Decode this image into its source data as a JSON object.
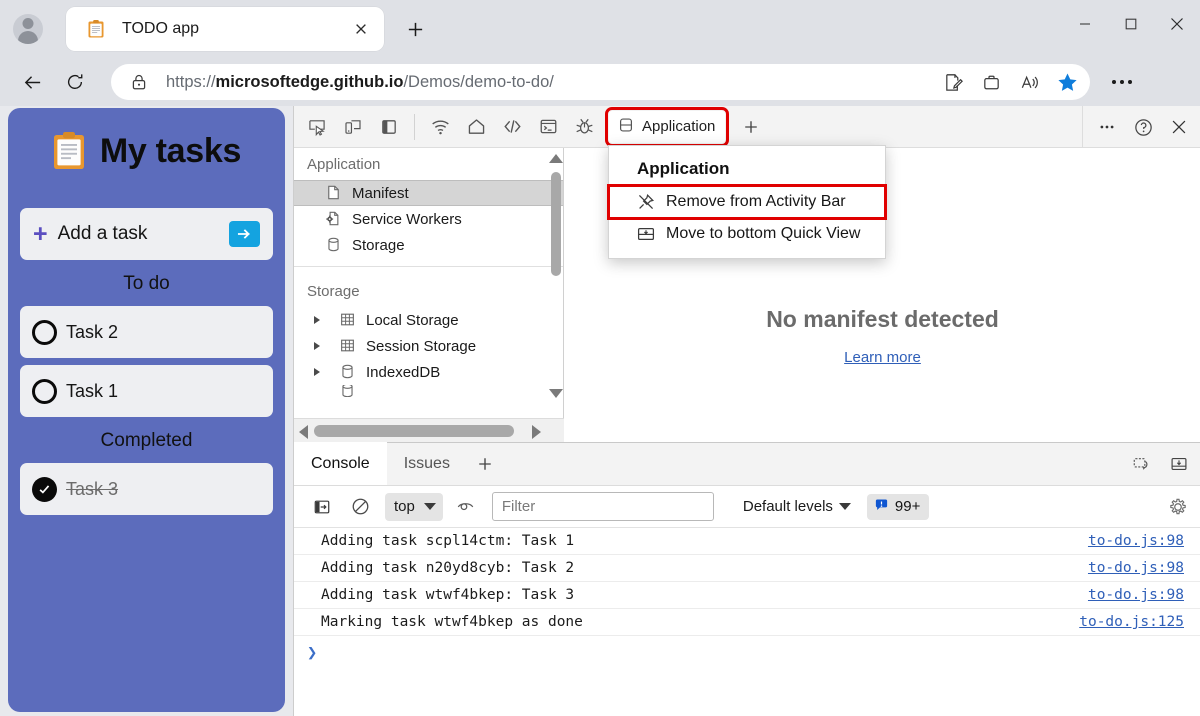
{
  "browser": {
    "profile_icon": "person-avatar-icon",
    "tab": {
      "favicon": "clipboard-icon",
      "title": "TODO app",
      "close_label": "×"
    },
    "new_tab_label": "+",
    "window_controls": {
      "minimize": "—",
      "maximize": "❑",
      "close": "×"
    },
    "nav": {
      "back_icon": "arrow-left-icon",
      "reload_icon": "reload-icon"
    },
    "omnibox": {
      "lock_icon": "lock-icon",
      "url_prefix": "https://",
      "url_host": "microsoftedge.github.io",
      "url_path": "/Demos/demo-to-do/",
      "full_url": "https://microsoftedge.github.io/Demos/demo-to-do/",
      "actions": [
        "read-aloud-icon",
        "collections-icon",
        "immersive-reader-icon",
        "favorites-star-icon"
      ]
    },
    "settings_more_icon": "ellipsis-icon"
  },
  "page": {
    "app_icon": "clipboard-icon",
    "app_title": "My tasks",
    "add_task": {
      "plus": "+",
      "label": "Add a task",
      "submit_icon": "arrow-right-icon"
    },
    "sections": [
      {
        "label": "To do",
        "tasks": [
          {
            "text": "Task 2",
            "done": false
          },
          {
            "text": "Task 1",
            "done": false
          }
        ]
      },
      {
        "label": "Completed",
        "tasks": [
          {
            "text": "Task 3",
            "done": true
          }
        ]
      }
    ],
    "accent_color": "#5c6cbc",
    "card_color": "#eeeff2",
    "submit_color": "#14a3e0"
  },
  "devtools": {
    "activity_bar": {
      "left_icons": [
        "inspect-element-icon",
        "device-emulation-icon",
        "toggle-side-panel-icon"
      ],
      "tool_icons": [
        "network-wifi-icon",
        "home-icon",
        "elements-code-icon",
        "console-terminal-icon",
        "debugger-bug-icon"
      ],
      "active_tab": {
        "icon": "application-storage-icon",
        "label": "Application"
      },
      "add_tab_label": "+",
      "right_icons": [
        "more-options-ellipsis-icon",
        "help-question-icon",
        "close-devtools-icon"
      ],
      "highlight_color": "#e00000"
    },
    "context_menu": {
      "header": "Application",
      "items": [
        {
          "icon": "unpin-icon",
          "label": "Remove from Activity Bar",
          "highlighted": true
        },
        {
          "icon": "move-to-bottom-panel-icon",
          "label": "Move to bottom Quick View",
          "highlighted": false
        }
      ]
    },
    "sidebar": {
      "groups": [
        {
          "title": "Application",
          "items": [
            {
              "icon": "document-icon",
              "label": "Manifest",
              "selected": true,
              "twisty": false
            },
            {
              "icon": "service-worker-gear-icon",
              "label": "Service Workers",
              "selected": false,
              "twisty": false
            },
            {
              "icon": "database-cylinder-icon",
              "label": "Storage",
              "selected": false,
              "twisty": false
            }
          ]
        },
        {
          "title": "Storage",
          "items": [
            {
              "icon": "table-grid-icon",
              "label": "Local Storage",
              "selected": false,
              "twisty": true
            },
            {
              "icon": "table-grid-icon",
              "label": "Session Storage",
              "selected": false,
              "twisty": true
            },
            {
              "icon": "database-cylinder-icon",
              "label": "IndexedDB",
              "selected": false,
              "twisty": true
            }
          ]
        }
      ],
      "vscroll_icon": "vertical-scrollbar",
      "hscroll_icon": "horizontal-scrollbar"
    },
    "main_panel": {
      "empty_heading": "No manifest detected",
      "learn_more_label": "Learn more",
      "learn_more_color": "#2f5fb8"
    },
    "drawer": {
      "tabs": [
        {
          "label": "Console",
          "active": true
        },
        {
          "label": "Issues",
          "active": false
        }
      ],
      "add_tab_label": "+",
      "right_icons": [
        "restore-quick-view-icon",
        "dock-to-bottom-icon"
      ],
      "console_toolbar": {
        "sidebar_toggle_icon": "console-sidebar-icon",
        "clear_icon": "clear-console-icon",
        "context_value": "top",
        "live_expression_icon": "eye-icon",
        "filter_placeholder": "Filter",
        "filter_value": "",
        "levels_label": "Default levels",
        "issues_count": "99+",
        "issues_icon": "issue-speech-bubble-icon",
        "settings_icon": "gear-icon"
      },
      "log_entries": [
        {
          "message": "Adding task scpl14ctm: Task 1",
          "source": "to-do.js:98"
        },
        {
          "message": "Adding task n20yd8cyb: Task 2",
          "source": "to-do.js:98"
        },
        {
          "message": "Adding task wtwf4bkep: Task 3",
          "source": "to-do.js:98"
        },
        {
          "message": "Marking task wtwf4bkep as done",
          "source": "to-do.js:125"
        }
      ],
      "prompt_glyph": "❯"
    }
  }
}
